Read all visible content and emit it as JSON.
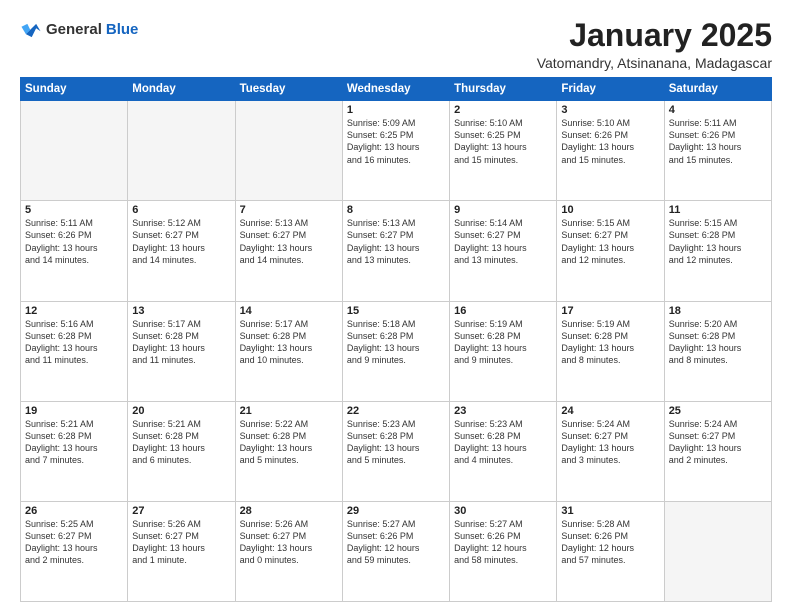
{
  "logo": {
    "general": "General",
    "blue": "Blue"
  },
  "header": {
    "month": "January 2025",
    "location": "Vatomandry, Atsinanana, Madagascar"
  },
  "weekdays": [
    "Sunday",
    "Monday",
    "Tuesday",
    "Wednesday",
    "Thursday",
    "Friday",
    "Saturday"
  ],
  "weeks": [
    [
      {
        "day": "",
        "info": ""
      },
      {
        "day": "",
        "info": ""
      },
      {
        "day": "",
        "info": ""
      },
      {
        "day": "1",
        "info": "Sunrise: 5:09 AM\nSunset: 6:25 PM\nDaylight: 13 hours\nand 16 minutes."
      },
      {
        "day": "2",
        "info": "Sunrise: 5:10 AM\nSunset: 6:25 PM\nDaylight: 13 hours\nand 15 minutes."
      },
      {
        "day": "3",
        "info": "Sunrise: 5:10 AM\nSunset: 6:26 PM\nDaylight: 13 hours\nand 15 minutes."
      },
      {
        "day": "4",
        "info": "Sunrise: 5:11 AM\nSunset: 6:26 PM\nDaylight: 13 hours\nand 15 minutes."
      }
    ],
    [
      {
        "day": "5",
        "info": "Sunrise: 5:11 AM\nSunset: 6:26 PM\nDaylight: 13 hours\nand 14 minutes."
      },
      {
        "day": "6",
        "info": "Sunrise: 5:12 AM\nSunset: 6:27 PM\nDaylight: 13 hours\nand 14 minutes."
      },
      {
        "day": "7",
        "info": "Sunrise: 5:13 AM\nSunset: 6:27 PM\nDaylight: 13 hours\nand 14 minutes."
      },
      {
        "day": "8",
        "info": "Sunrise: 5:13 AM\nSunset: 6:27 PM\nDaylight: 13 hours\nand 13 minutes."
      },
      {
        "day": "9",
        "info": "Sunrise: 5:14 AM\nSunset: 6:27 PM\nDaylight: 13 hours\nand 13 minutes."
      },
      {
        "day": "10",
        "info": "Sunrise: 5:15 AM\nSunset: 6:27 PM\nDaylight: 13 hours\nand 12 minutes."
      },
      {
        "day": "11",
        "info": "Sunrise: 5:15 AM\nSunset: 6:28 PM\nDaylight: 13 hours\nand 12 minutes."
      }
    ],
    [
      {
        "day": "12",
        "info": "Sunrise: 5:16 AM\nSunset: 6:28 PM\nDaylight: 13 hours\nand 11 minutes."
      },
      {
        "day": "13",
        "info": "Sunrise: 5:17 AM\nSunset: 6:28 PM\nDaylight: 13 hours\nand 11 minutes."
      },
      {
        "day": "14",
        "info": "Sunrise: 5:17 AM\nSunset: 6:28 PM\nDaylight: 13 hours\nand 10 minutes."
      },
      {
        "day": "15",
        "info": "Sunrise: 5:18 AM\nSunset: 6:28 PM\nDaylight: 13 hours\nand 9 minutes."
      },
      {
        "day": "16",
        "info": "Sunrise: 5:19 AM\nSunset: 6:28 PM\nDaylight: 13 hours\nand 9 minutes."
      },
      {
        "day": "17",
        "info": "Sunrise: 5:19 AM\nSunset: 6:28 PM\nDaylight: 13 hours\nand 8 minutes."
      },
      {
        "day": "18",
        "info": "Sunrise: 5:20 AM\nSunset: 6:28 PM\nDaylight: 13 hours\nand 8 minutes."
      }
    ],
    [
      {
        "day": "19",
        "info": "Sunrise: 5:21 AM\nSunset: 6:28 PM\nDaylight: 13 hours\nand 7 minutes."
      },
      {
        "day": "20",
        "info": "Sunrise: 5:21 AM\nSunset: 6:28 PM\nDaylight: 13 hours\nand 6 minutes."
      },
      {
        "day": "21",
        "info": "Sunrise: 5:22 AM\nSunset: 6:28 PM\nDaylight: 13 hours\nand 5 minutes."
      },
      {
        "day": "22",
        "info": "Sunrise: 5:23 AM\nSunset: 6:28 PM\nDaylight: 13 hours\nand 5 minutes."
      },
      {
        "day": "23",
        "info": "Sunrise: 5:23 AM\nSunset: 6:28 PM\nDaylight: 13 hours\nand 4 minutes."
      },
      {
        "day": "24",
        "info": "Sunrise: 5:24 AM\nSunset: 6:27 PM\nDaylight: 13 hours\nand 3 minutes."
      },
      {
        "day": "25",
        "info": "Sunrise: 5:24 AM\nSunset: 6:27 PM\nDaylight: 13 hours\nand 2 minutes."
      }
    ],
    [
      {
        "day": "26",
        "info": "Sunrise: 5:25 AM\nSunset: 6:27 PM\nDaylight: 13 hours\nand 2 minutes."
      },
      {
        "day": "27",
        "info": "Sunrise: 5:26 AM\nSunset: 6:27 PM\nDaylight: 13 hours\nand 1 minute."
      },
      {
        "day": "28",
        "info": "Sunrise: 5:26 AM\nSunset: 6:27 PM\nDaylight: 13 hours\nand 0 minutes."
      },
      {
        "day": "29",
        "info": "Sunrise: 5:27 AM\nSunset: 6:26 PM\nDaylight: 12 hours\nand 59 minutes."
      },
      {
        "day": "30",
        "info": "Sunrise: 5:27 AM\nSunset: 6:26 PM\nDaylight: 12 hours\nand 58 minutes."
      },
      {
        "day": "31",
        "info": "Sunrise: 5:28 AM\nSunset: 6:26 PM\nDaylight: 12 hours\nand 57 minutes."
      },
      {
        "day": "",
        "info": ""
      }
    ]
  ]
}
